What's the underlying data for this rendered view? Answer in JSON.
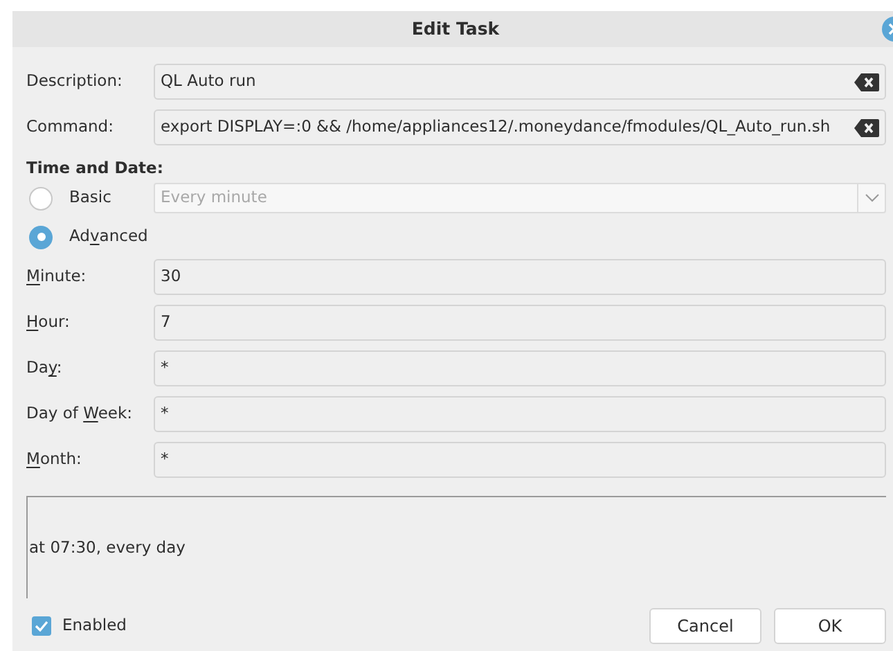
{
  "window": {
    "title": "Edit Task"
  },
  "text_fields": [
    {
      "label": "Description:",
      "value": "QL Auto run"
    },
    {
      "label": "Command:",
      "value": "export DISPLAY=:0 && /home/appliances12/.moneydance/fmodules/QL_Auto_run.sh"
    }
  ],
  "section_title": "Time and Date:",
  "modes": [
    {
      "kind": "combo",
      "label": "Basic",
      "selected": false,
      "value": "Every minute"
    },
    {
      "kind": "plain",
      "label": {
        "before": "Ad",
        "underlined": "v",
        "after": "anced"
      },
      "selected": true
    }
  ],
  "schedule_fields": [
    {
      "label": {
        "underlined": "M",
        "after": "inute:"
      },
      "value": "30"
    },
    {
      "label": {
        "underlined": "H",
        "after": "our:"
      },
      "value": "7"
    },
    {
      "label": {
        "before": "Da",
        "underlined": "y",
        "after": ":"
      },
      "value": "*"
    },
    {
      "label": {
        "before": "Day of ",
        "underlined": "W",
        "after": "eek:"
      },
      "value": "*"
    },
    {
      "label": {
        "underlined": "M",
        "after": "onth:"
      },
      "value": "*"
    }
  ],
  "summary": "at 07:30, every day",
  "enabled": {
    "label": "Enabled",
    "checked": true
  },
  "buttons": [
    "Cancel",
    "OK"
  ]
}
